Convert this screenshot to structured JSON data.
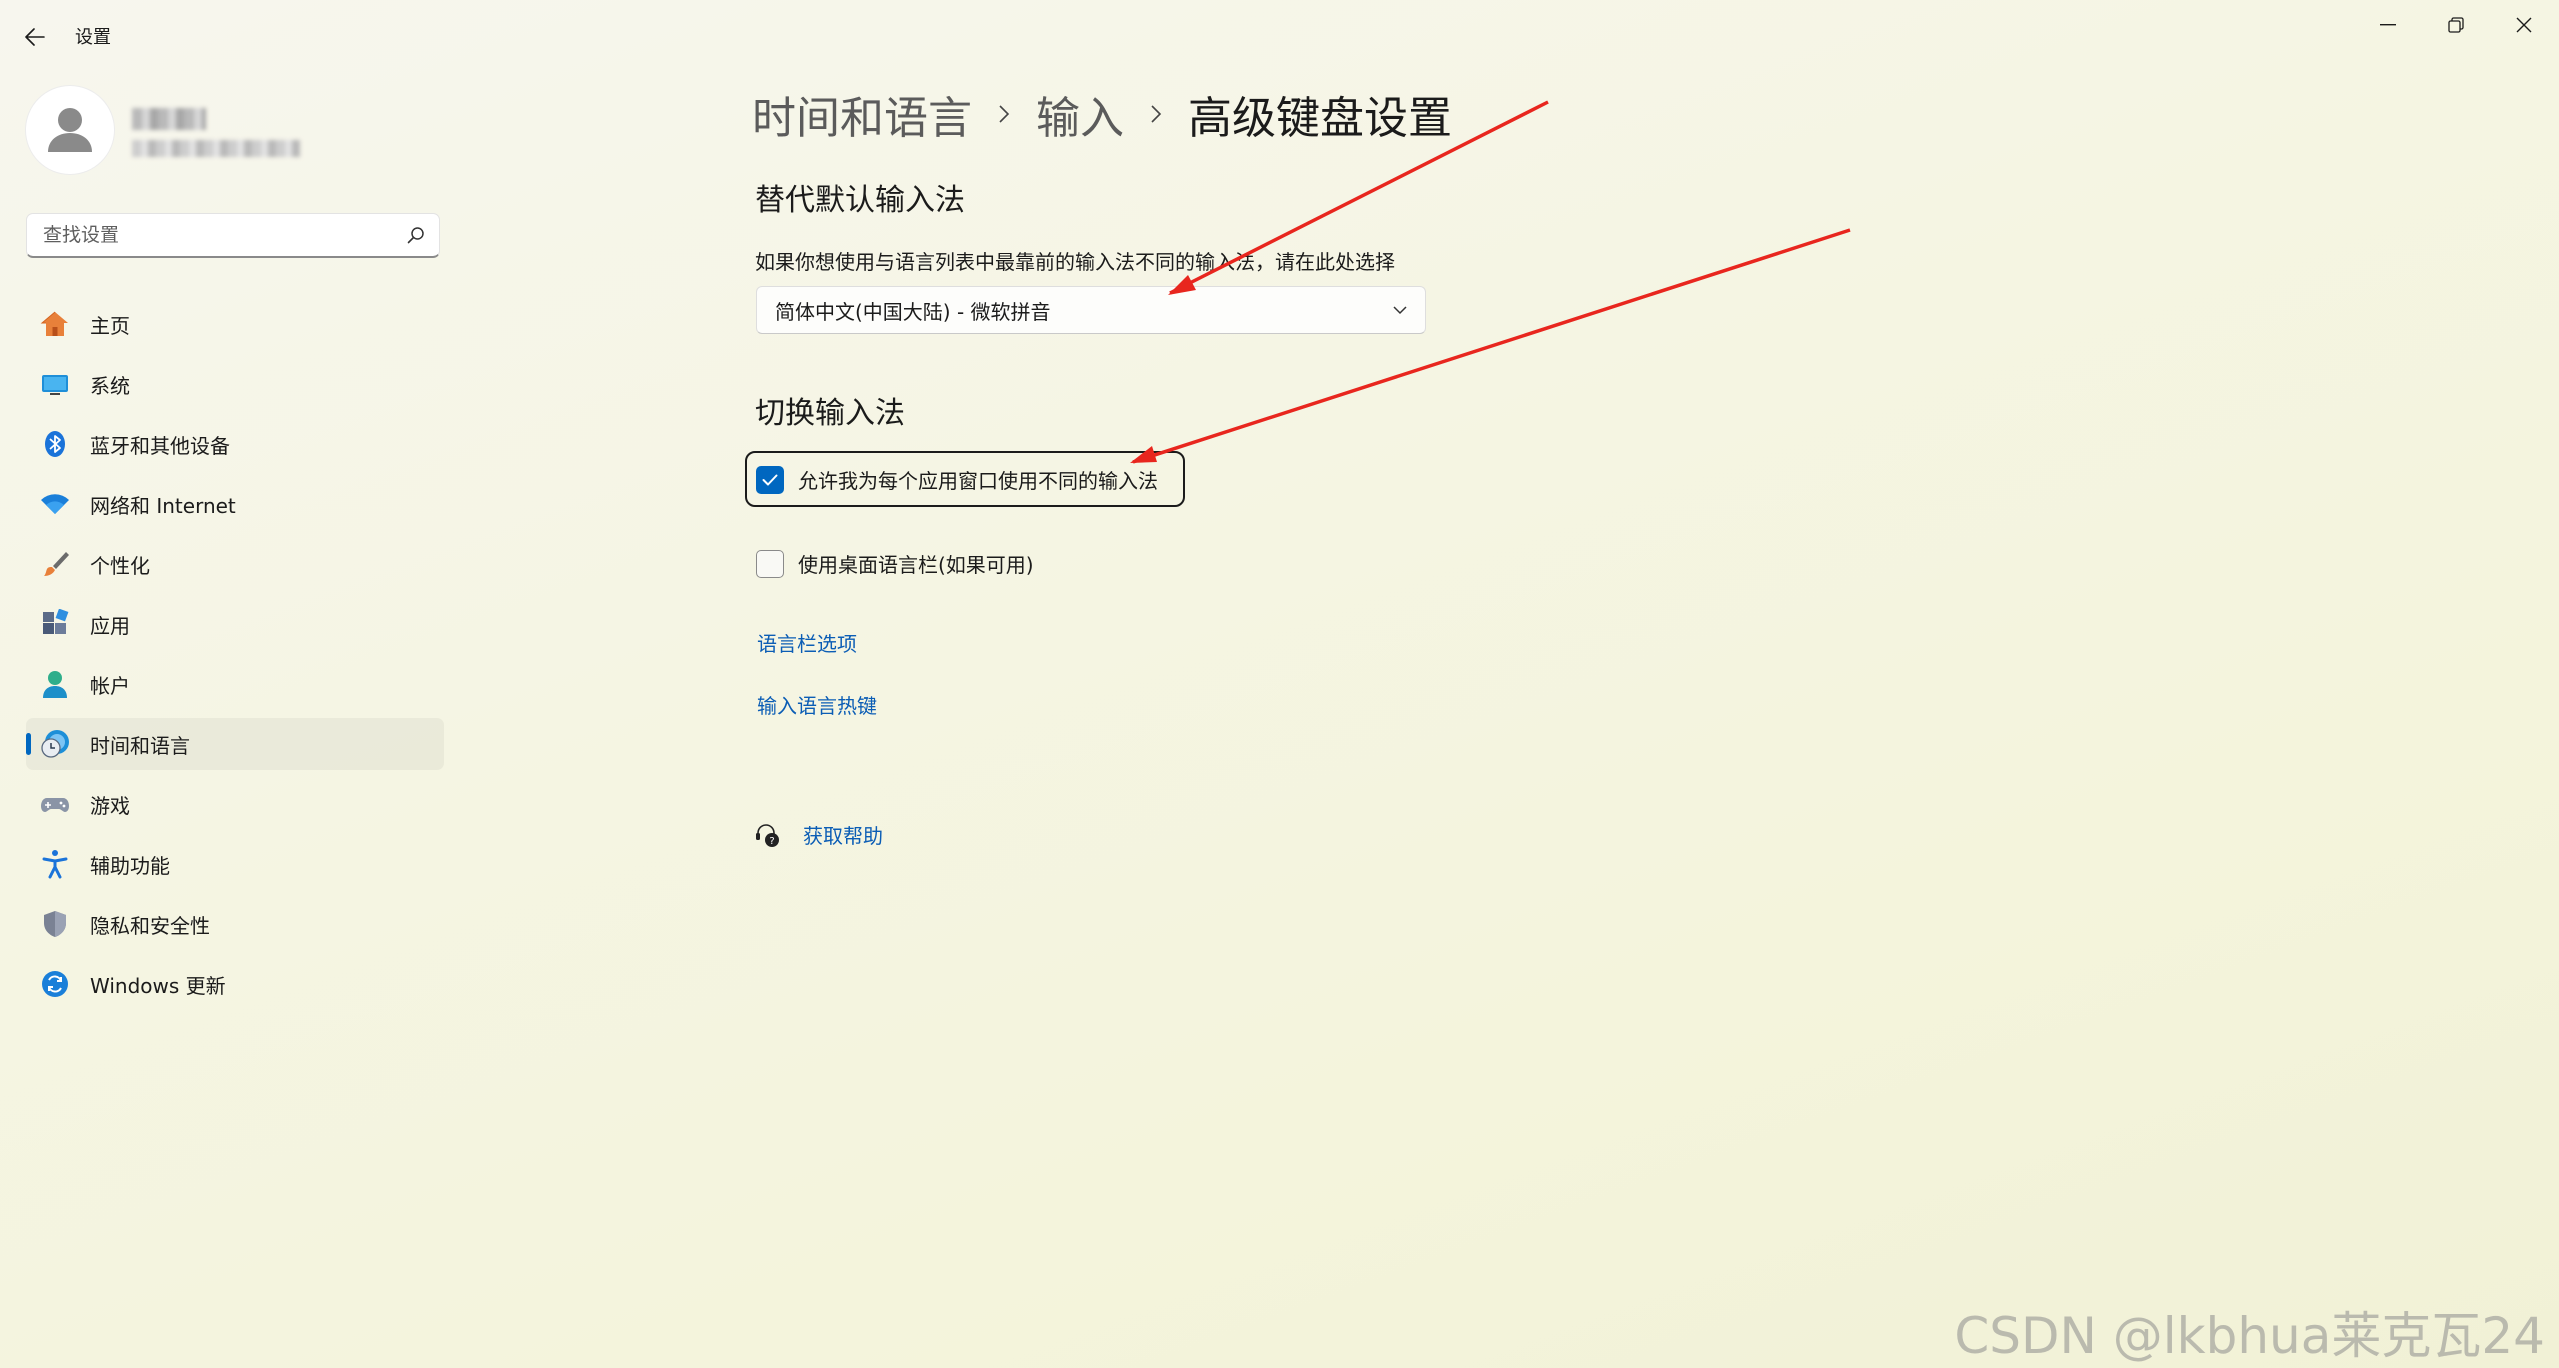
{
  "window": {
    "title": "设置",
    "controls": [
      "minimize-icon",
      "restore-icon",
      "close-icon"
    ]
  },
  "search": {
    "placeholder": "查找设置"
  },
  "sidebar": {
    "items": [
      {
        "label": "主页",
        "icon": "home-icon"
      },
      {
        "label": "系统",
        "icon": "system-icon"
      },
      {
        "label": "蓝牙和其他设备",
        "icon": "bluetooth-icon"
      },
      {
        "label": "网络和 Internet",
        "icon": "wifi-icon"
      },
      {
        "label": "个性化",
        "icon": "brush-icon"
      },
      {
        "label": "应用",
        "icon": "apps-icon"
      },
      {
        "label": "帐户",
        "icon": "account-icon"
      },
      {
        "label": "时间和语言",
        "icon": "time-language-icon",
        "active": true
      },
      {
        "label": "游戏",
        "icon": "gamepad-icon"
      },
      {
        "label": "辅助功能",
        "icon": "accessibility-icon"
      },
      {
        "label": "隐私和安全性",
        "icon": "shield-icon"
      },
      {
        "label": "Windows 更新",
        "icon": "update-icon"
      }
    ]
  },
  "breadcrumb": [
    "时间和语言",
    "输入",
    "高级键盘设置"
  ],
  "section1": {
    "title": "替代默认输入法",
    "description": "如果你想使用与语言列表中最靠前的输入法不同的输入法，请在此处选择",
    "dropdown_value": "简体中文(中国大陆) - 微软拼音"
  },
  "section2": {
    "title": "切换输入法",
    "checkbox1": {
      "label": "允许我为每个应用窗口使用不同的输入法",
      "checked": true
    },
    "checkbox2": {
      "label": "使用桌面语言栏(如果可用)",
      "checked": false
    }
  },
  "links": {
    "language_bar_options": "语言栏选项",
    "input_language_hotkeys": "输入语言热键",
    "get_help": "获取帮助"
  },
  "colors": {
    "accent": "#0067c0",
    "link": "#0b5db5",
    "annotation_arrow": "#e8261e"
  },
  "watermark": "CSDN @lkbhua莱克瓦24"
}
